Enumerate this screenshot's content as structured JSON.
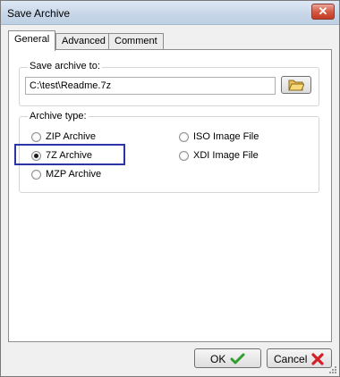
{
  "window": {
    "title": "Save Archive",
    "close_glyph": "✕"
  },
  "tabs": [
    {
      "label": "General",
      "active": true
    },
    {
      "label": "Advanced",
      "active": false
    },
    {
      "label": "Comment",
      "active": false
    }
  ],
  "save_to": {
    "label": "Save archive to:",
    "value": "C:\\test\\Readme.7z",
    "browse_icon": "folder-open-icon"
  },
  "archive_type": {
    "label": "Archive type:",
    "options": [
      {
        "label": "ZIP Archive",
        "checked": false
      },
      {
        "label": "7Z Archive",
        "checked": true
      },
      {
        "label": "MZP Archive",
        "checked": false
      },
      {
        "label": "ISO Image File",
        "checked": false
      },
      {
        "label": "XDI Image File",
        "checked": false
      }
    ]
  },
  "buttons": {
    "ok": {
      "label": "OK",
      "icon": "checkmark-icon",
      "color": "#2f9e2f"
    },
    "cancel": {
      "label": "Cancel",
      "icon": "cross-icon",
      "color": "#d2202a"
    }
  }
}
